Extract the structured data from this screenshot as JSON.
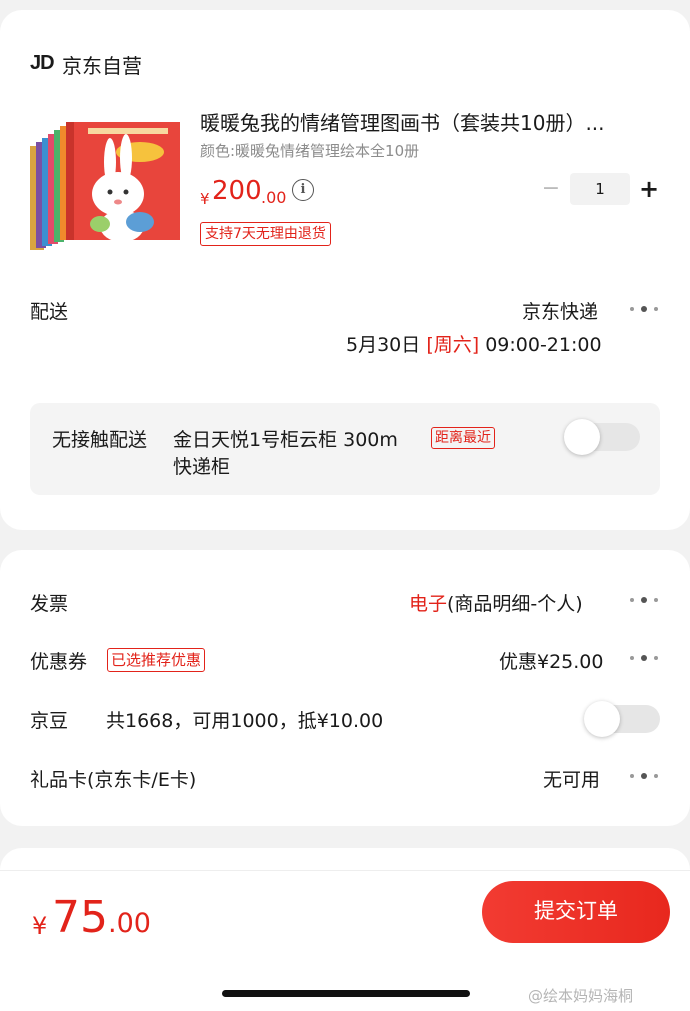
{
  "shop": {
    "logo": "JD",
    "name": "京东自营"
  },
  "product": {
    "title": "暖暖兔我的情绪管理图画书（套装共10册）...",
    "variant": "颜色:暖暖兔情绪管理绘本全10册",
    "price_symbol": "¥",
    "price_int": "200",
    "price_dec": ".00",
    "info_icon": "i",
    "quantity": "1",
    "minus_symbol": "−",
    "plus_symbol": "+",
    "return_tag": "支持7天无理由退货"
  },
  "delivery": {
    "label": "配送",
    "method": "京东快递",
    "date": "5月30日",
    "weekday": "[周六]",
    "time": "09:00-21:00",
    "contactless": {
      "label": "无接触配送",
      "address_line1": "金日天悦1号柜云柜 300m",
      "address_line2": "快递柜",
      "tag": "距离最近",
      "enabled": false
    }
  },
  "invoice": {
    "label": "发票",
    "value_highlight": "电子",
    "value_rest": "(商品明细-个人)"
  },
  "coupon": {
    "label": "优惠券",
    "tag": "已选推荐优惠",
    "value": "优惠¥25.00"
  },
  "jingdou": {
    "label": "京豆",
    "detail": "共1668，可用1000，抵¥10.00",
    "enabled": false
  },
  "giftcard": {
    "label": "礼品卡(京东卡/E卡)",
    "value": "无可用"
  },
  "footer": {
    "total_symbol": "¥",
    "total_int": "75",
    "total_dec": ".00",
    "submit_label": "提交订单",
    "watermark": "@绘本妈妈海桐"
  },
  "colors": {
    "accent": "#e2231a",
    "background": "#f2f2f2"
  }
}
